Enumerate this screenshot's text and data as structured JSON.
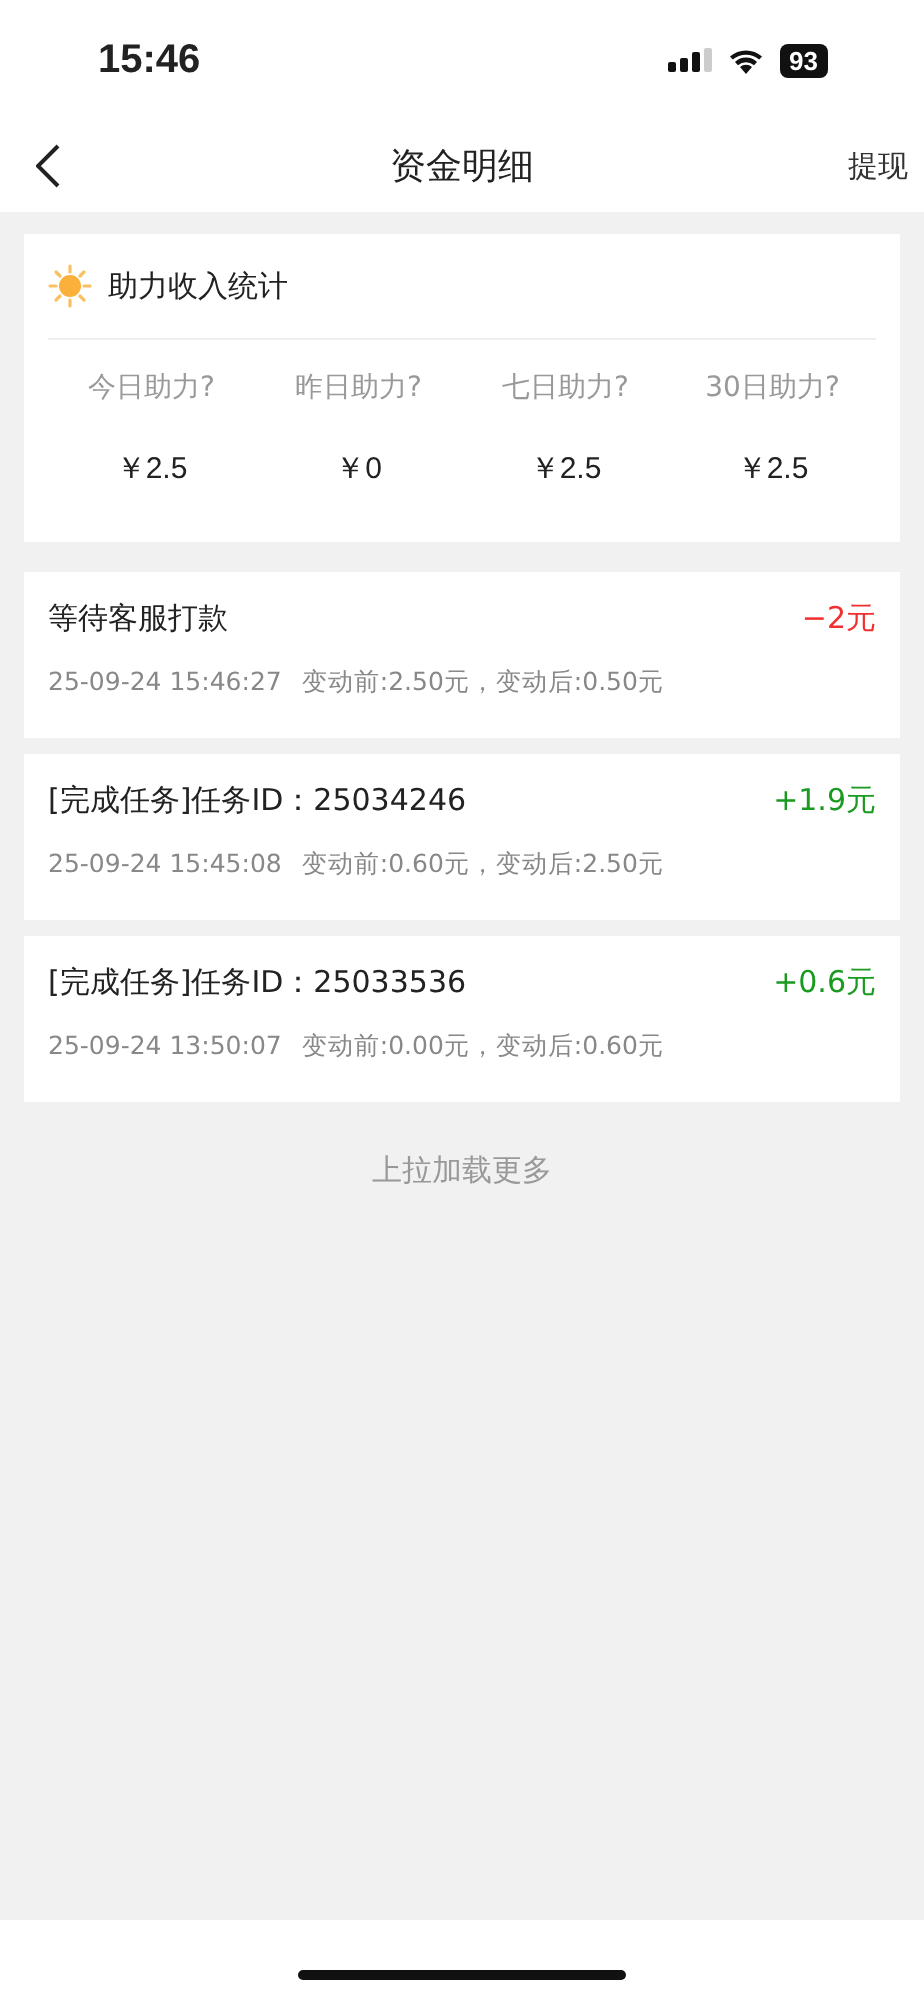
{
  "status_bar": {
    "time": "15:46",
    "battery": "93"
  },
  "nav": {
    "title": "资金明细",
    "action": "提现"
  },
  "stats": {
    "title": "助力收入统计",
    "items": [
      {
        "label": "今日助力?",
        "value": "￥2.5"
      },
      {
        "label": "昨日助力?",
        "value": "￥0"
      },
      {
        "label": "七日助力?",
        "value": "￥2.5"
      },
      {
        "label": "30日助力?",
        "value": "￥2.5"
      }
    ]
  },
  "records": [
    {
      "title": "等待客服打款",
      "amount": "−2元",
      "kind": "debit",
      "time": "25-09-24 15:46:27",
      "change": "变动前:2.50元，变动后:0.50元"
    },
    {
      "title": "[完成任务]任务ID：25034246",
      "amount": "+1.9元",
      "kind": "credit",
      "time": "25-09-24 15:45:08",
      "change": "变动前:0.60元，变动后:2.50元"
    },
    {
      "title": "[完成任务]任务ID：25033536",
      "amount": "+0.6元",
      "kind": "credit",
      "time": "25-09-24 13:50:07",
      "change": "变动前:0.00元，变动后:0.60元"
    }
  ],
  "load_more": "上拉加载更多"
}
